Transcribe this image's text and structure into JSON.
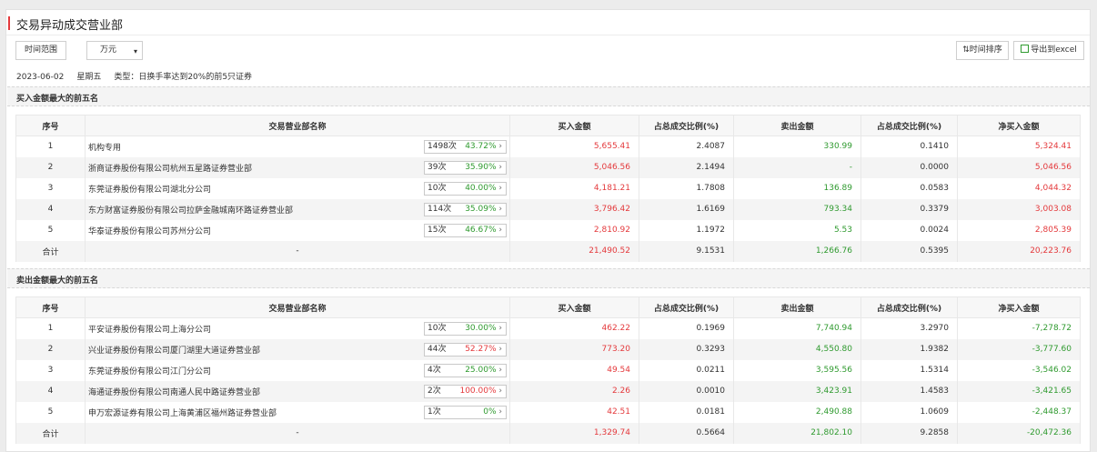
{
  "header": {
    "title": "交易异动成交营业部"
  },
  "toolbar": {
    "time_range_label": "时间范围",
    "unit_select": "万元",
    "sort_label": "时间排序",
    "export_label": "导出到excel"
  },
  "info": {
    "date": "2023-06-02",
    "weekday": "星期五",
    "type": "类型：日换手率达到20%的前5只证券"
  },
  "columns": [
    "序号",
    "交易营业部名称",
    "买入金额",
    "占总成交比例(%)",
    "卖出金额",
    "占总成交比例(%)",
    "净买入金额"
  ],
  "buy_section": {
    "title": "买入金额最大的前五名",
    "rows": [
      {
        "rank": "1",
        "name": "机构专用",
        "count": "1498次",
        "pct": "43.72%",
        "pct_color": "green",
        "buy": "5,655.41",
        "buy_ratio": "2.4087",
        "sell": "330.99",
        "sell_ratio": "0.1410",
        "net": "5,324.41",
        "net_color": "red"
      },
      {
        "rank": "2",
        "name": "浙商证券股份有限公司杭州五星路证券营业部",
        "count": "39次",
        "pct": "35.90%",
        "pct_color": "green",
        "buy": "5,046.56",
        "buy_ratio": "2.1494",
        "sell": "-",
        "sell_ratio": "0.0000",
        "net": "5,046.56",
        "net_color": "red"
      },
      {
        "rank": "3",
        "name": "东莞证券股份有限公司湖北分公司",
        "count": "10次",
        "pct": "40.00%",
        "pct_color": "green",
        "buy": "4,181.21",
        "buy_ratio": "1.7808",
        "sell": "136.89",
        "sell_ratio": "0.0583",
        "net": "4,044.32",
        "net_color": "red"
      },
      {
        "rank": "4",
        "name": "东方财富证券股份有限公司拉萨金融城南环路证券营业部",
        "count": "114次",
        "pct": "35.09%",
        "pct_color": "green",
        "buy": "3,796.42",
        "buy_ratio": "1.6169",
        "sell": "793.34",
        "sell_ratio": "0.3379",
        "net": "3,003.08",
        "net_color": "red"
      },
      {
        "rank": "5",
        "name": "华泰证券股份有限公司苏州分公司",
        "count": "15次",
        "pct": "46.67%",
        "pct_color": "green",
        "buy": "2,810.92",
        "buy_ratio": "1.1972",
        "sell": "5.53",
        "sell_ratio": "0.0024",
        "net": "2,805.39",
        "net_color": "red"
      }
    ],
    "total": {
      "label": "合计",
      "name": "-",
      "buy": "21,490.52",
      "buy_ratio": "9.1531",
      "sell": "1,266.76",
      "sell_ratio": "0.5395",
      "net": "20,223.76",
      "net_color": "red"
    }
  },
  "sell_section": {
    "title": "卖出金额最大的前五名",
    "rows": [
      {
        "rank": "1",
        "name": "平安证券股份有限公司上海分公司",
        "count": "10次",
        "pct": "30.00%",
        "pct_color": "green",
        "buy": "462.22",
        "buy_ratio": "0.1969",
        "sell": "7,740.94",
        "sell_ratio": "3.2970",
        "net": "-7,278.72",
        "net_color": "green"
      },
      {
        "rank": "2",
        "name": "兴业证券股份有限公司厦门湖里大道证券营业部",
        "count": "44次",
        "pct": "52.27%",
        "pct_color": "red",
        "buy": "773.20",
        "buy_ratio": "0.3293",
        "sell": "4,550.80",
        "sell_ratio": "1.9382",
        "net": "-3,777.60",
        "net_color": "green"
      },
      {
        "rank": "3",
        "name": "东莞证券股份有限公司江门分公司",
        "count": "4次",
        "pct": "25.00%",
        "pct_color": "green",
        "buy": "49.54",
        "buy_ratio": "0.0211",
        "sell": "3,595.56",
        "sell_ratio": "1.5314",
        "net": "-3,546.02",
        "net_color": "green"
      },
      {
        "rank": "4",
        "name": "海通证券股份有限公司南通人民中路证券营业部",
        "count": "2次",
        "pct": "100.00%",
        "pct_color": "red",
        "buy": "2.26",
        "buy_ratio": "0.0010",
        "sell": "3,423.91",
        "sell_ratio": "1.4583",
        "net": "-3,421.65",
        "net_color": "green"
      },
      {
        "rank": "5",
        "name": "申万宏源证券有限公司上海黄浦区福州路证券营业部",
        "count": "1次",
        "pct": "0%",
        "pct_color": "green",
        "buy": "42.51",
        "buy_ratio": "0.0181",
        "sell": "2,490.88",
        "sell_ratio": "1.0609",
        "net": "-2,448.37",
        "net_color": "green"
      }
    ],
    "total": {
      "label": "合计",
      "name": "-",
      "buy": "1,329.74",
      "buy_ratio": "0.5664",
      "sell": "21,802.10",
      "sell_ratio": "9.2858",
      "net": "-20,472.36",
      "net_color": "green"
    }
  },
  "colors": {
    "red": "#e4393c",
    "green": "#2f9a2f",
    "accent_bar": "#e4393c"
  }
}
